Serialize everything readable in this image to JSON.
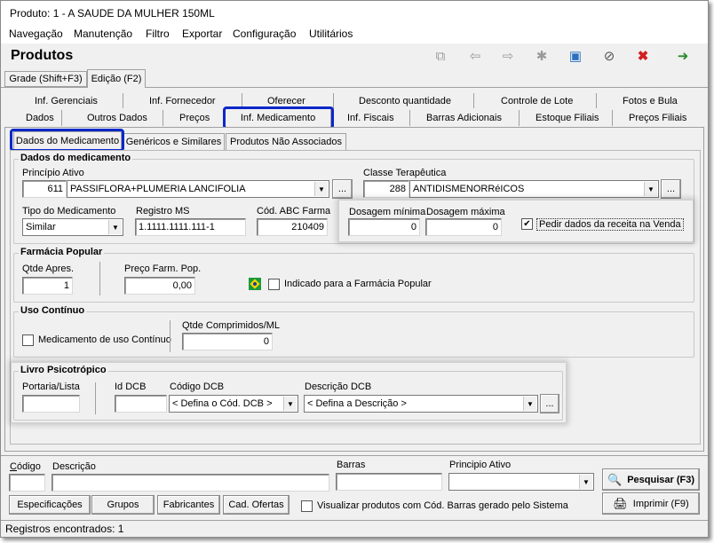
{
  "window": {
    "title": "Produto: 1 - A SAUDE DA MULHER 150ML"
  },
  "menu": [
    "Navegação",
    "Manutenção",
    "Filtro",
    "Exportar",
    "Configuração",
    "Utilitários"
  ],
  "header": {
    "title": "Produtos"
  },
  "toolbar": [
    "copy-icon",
    "arrow-left-icon",
    "arrow-right-icon",
    "new-icon",
    "save-icon",
    "cancel-icon",
    "delete-icon",
    "exit-icon"
  ],
  "mode_tabs": [
    "Grade (Shift+F3)",
    "Edição (F2)"
  ],
  "tabs_row1": [
    "Inf. Gerenciais",
    "Inf. Fornecedor",
    "Oferecer",
    "Desconto quantidade",
    "Controle de Lote",
    "Fotos e Bula"
  ],
  "tabs_row2": [
    "Dados",
    "Outros Dados",
    "Preços",
    "Inf. Medicamento",
    "Inf. Fiscais",
    "Barras Adicionais",
    "Estoque Filiais",
    "Preços Filiais"
  ],
  "sub_tabs": [
    "Dados do Medicamento",
    "Genéricos e Similares",
    "Produtos Não Associados"
  ],
  "dados": {
    "title": "Dados do medicamento",
    "principio_label": "Princípio Ativo",
    "principio_code": "611",
    "principio_value": "PASSIFLORA+PLUMERIA LANCIFOLIA",
    "classe_label": "Classe Terapêutica",
    "classe_code": "288",
    "classe_value": "ANTIDISMENORRéICOS",
    "tipo_label": "Tipo do Medicamento",
    "tipo_value": "Similar",
    "registro_label": "Registro MS",
    "registro_value": "1.1111.1111.111-1",
    "abc_label": "Cód. ABC Farma",
    "abc_value": "210409",
    "dos_min_label": "Dosagem mínima",
    "dos_min_value": "0",
    "dos_max_label": "Dosagem máxima",
    "dos_max_value": "0",
    "pedir_label": "Pedir dados da receita na Venda",
    "ellipsis": "..."
  },
  "farmacia": {
    "title": "Farmácia Popular",
    "qtde_label": "Qtde Apres.",
    "qtde_value": "1",
    "preco_label": "Preço Farm. Pop.",
    "preco_value": "0,00",
    "indicado_label": "Indicado para a Farmácia Popular"
  },
  "uso": {
    "title": "Uso Contínuo",
    "med_label": "Medicamento de uso Contínuo",
    "qtde_label": "Qtde Comprimidos/ML",
    "qtde_value": "0"
  },
  "livro": {
    "title": "Livro Psicotrópico",
    "portaria_label": "Portaria/Lista",
    "idcb_label": "Id DCB",
    "codigo_label": "Código DCB",
    "codigo_value": "< Defina o Cód. DCB >",
    "descricao_label": "Descrição DCB",
    "descricao_value": "< Defina a Descrição >"
  },
  "search": {
    "codigo_label": "Código",
    "descricao_label": "Descrição",
    "barras_label": "Barras",
    "principio_label": "Principio Ativo",
    "pesquisar": "Pesquisar (F3)",
    "imprimir": "Imprimir (F9)",
    "especificacoes": "Especificações",
    "grupos": "Grupos",
    "fabricantes": "Fabricantes",
    "cad_ofertas": "Cad. Ofertas",
    "visualizar_label": "Visualizar produtos com Cód. Barras gerado pelo Sistema"
  },
  "status": {
    "text": "Registros encontrados: 1"
  },
  "colors": {
    "highlight": "#0a28c8",
    "window_bg": "#f0f0f0"
  }
}
